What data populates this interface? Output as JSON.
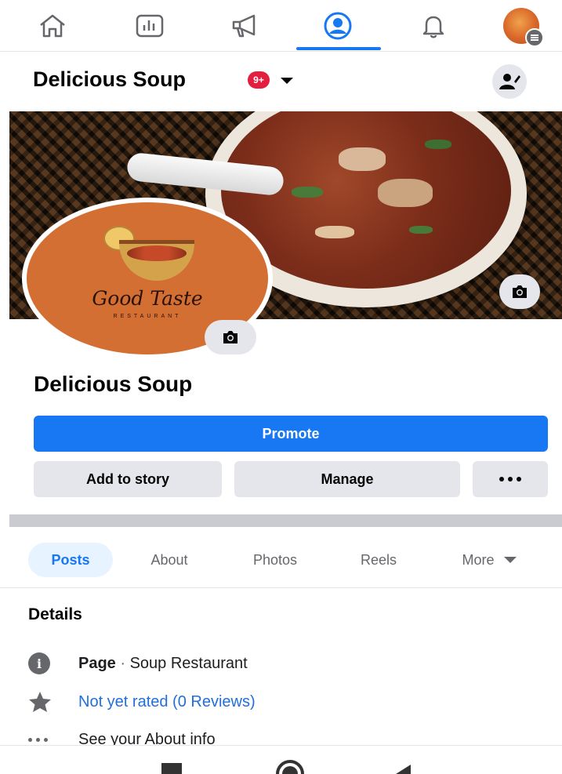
{
  "nav": {
    "items": [
      {
        "icon": "home-icon"
      },
      {
        "icon": "insights-icon"
      },
      {
        "icon": "megaphone-icon"
      },
      {
        "icon": "profile-icon",
        "active": true
      },
      {
        "icon": "bell-icon"
      },
      {
        "icon": "avatar-menu-icon"
      }
    ]
  },
  "header": {
    "title": "Delicious Soup",
    "badge": "9+"
  },
  "profile": {
    "logo_script": "Good Taste",
    "logo_sub": "RESTAURANT",
    "name": "Delicious Soup"
  },
  "actions": {
    "promote": "Promote",
    "add_to_story": "Add to story",
    "manage": "Manage"
  },
  "tabs": [
    {
      "label": "Posts",
      "active": true
    },
    {
      "label": "About"
    },
    {
      "label": "Photos"
    },
    {
      "label": "Reels"
    },
    {
      "label": "More"
    }
  ],
  "details": {
    "title": "Details",
    "page_label": "Page",
    "page_sep": " · ",
    "page_category": "Soup Restaurant",
    "rating": "Not yet rated (0 Reviews)",
    "about": "See your About info"
  },
  "colors": {
    "accent": "#1877f2",
    "badge": "#e41e3f",
    "link": "#216fdb"
  }
}
